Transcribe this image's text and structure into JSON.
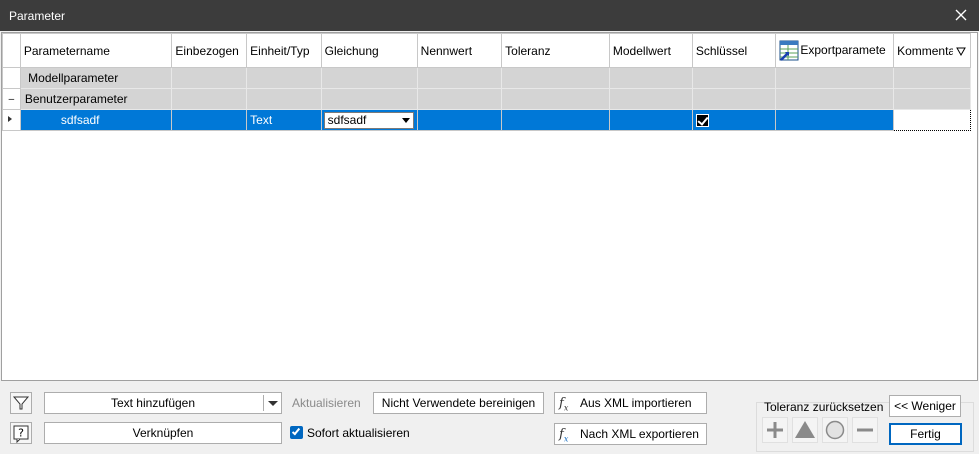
{
  "window": {
    "title": "Parameter"
  },
  "grid": {
    "columns": [
      "Parametername",
      "Einbezogen",
      "Einheit/Typ",
      "Gleichung",
      "Nennwert",
      "Toleranz",
      "Modellwert",
      "Schlüssel",
      "Exportparamete",
      "Kommentar"
    ],
    "groups": [
      {
        "label": "Modellparameter",
        "expander": ""
      },
      {
        "label": "Benutzerparameter",
        "expander": "–"
      }
    ],
    "rows": [
      {
        "name": "sdfsadf",
        "unit": "Text",
        "equation": "sdfsadf",
        "key_checked": true
      }
    ]
  },
  "toolbar": {
    "add_text": "Text hinzufügen",
    "link": "Verknüpfen",
    "update": "Aktualisieren",
    "cleanup": "Nicht Verwendete bereinigen",
    "auto_update": "Sofort aktualisieren",
    "auto_update_checked": true,
    "import_xml": "Aus XML importieren",
    "export_xml": "Nach XML exportieren",
    "tolerance_reset": "Toleranz zurücksetzen",
    "less": "<< Weniger",
    "done": "Fertig"
  },
  "icons": [
    "close-icon",
    "filter-icon",
    "help-icon",
    "fx-import-icon",
    "fx-export-icon",
    "plus-icon",
    "triangle-icon",
    "circle-icon",
    "minus-icon",
    "export-table-icon",
    "sort-down-icon"
  ]
}
